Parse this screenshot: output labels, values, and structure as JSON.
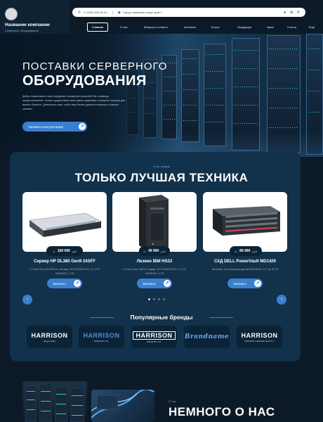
{
  "company": {
    "name": "Название компании",
    "subtitle": "Серверное оборудование"
  },
  "topbar": {
    "phone": "+7 (000) 000-00-00",
    "address": "Город, название улицы, дом 1",
    "social": [
      "telegram-icon",
      "vk-icon",
      "phone-icon"
    ]
  },
  "nav": {
    "items": [
      "Главная",
      "О нас",
      "Вопросы и ответы",
      "Контакты",
      "Услуги",
      "Продукция",
      "Цены",
      "Статьи",
      "Ещё"
    ]
  },
  "hero": {
    "title_line1": "ПОСТАВКИ СЕРВЕРНОГО",
    "title_line2": "ОБОРУДОВАНИЯ",
    "description": "Добро пожаловать в мир передовых серверных решений! Мы, команда профессионалов, готовы предоставить вам самые надежные и мощные сервера для вашего бизнеса. Доверьтесь нам, чтобы ваш бизнес двигался вперед с новыми силами!",
    "cta_label": "Заказать консультацию"
  },
  "products": {
    "eyebrow": "Хиты продаж",
    "title": "ТОЛЬКО ЛУЧШАЯ ТЕХНИКА",
    "items": [
      {
        "from": "от",
        "price": "169 990",
        "currency": "руб",
        "name": "Сервер HP DL380 Gen9 24SFF",
        "spec": "2 x Intel Xeon E5-2697v4, 18-ядер, 64 Гб DDR4 ECC, 8 x 2.5\" SAS/SATA, 2 ТБ",
        "button": "Заказать"
      },
      {
        "from": "от",
        "price": "49 990",
        "currency": "руб",
        "name": "Лезвие IBM HS22",
        "spec": "2 x Intel Xeon X5675, 6-ядер, 32 Гб DDR3 ECC, 2 x 2.5\" SAS/SATA, 2 ТБ",
        "button": "Заказать"
      },
      {
        "from": "от",
        "price": "89 990",
        "currency": "руб",
        "name": "СХД DELL PowerVault MD1420",
        "spec": "Внешняя, 24 отсека для дисков SAS/SATA, 2.5\" до 96 Тб",
        "button": "Заказать"
      }
    ],
    "pagination": {
      "count": 4,
      "active": 1
    }
  },
  "brands": {
    "title": "Популярные бренды",
    "items": [
      {
        "name": "HARRISON",
        "sub": "design studio",
        "color": "#ffffff"
      },
      {
        "name": "HARRISON",
        "sub": "INDUSTRY CO.",
        "color": "#4a8fe0"
      },
      {
        "name": "HARRISON",
        "sub": "INDUSTRY CO.",
        "color": "#ffffff"
      },
      {
        "name": "Brandname",
        "sub": "",
        "color": "#6aa8ff"
      },
      {
        "name": "HARRISON",
        "sub": "ORIGINAL GENUINE QUALITY",
        "color": "#ffffff"
      }
    ]
  },
  "about": {
    "eyebrow": "О нас",
    "title": "НЕМНОГО О НАС"
  }
}
